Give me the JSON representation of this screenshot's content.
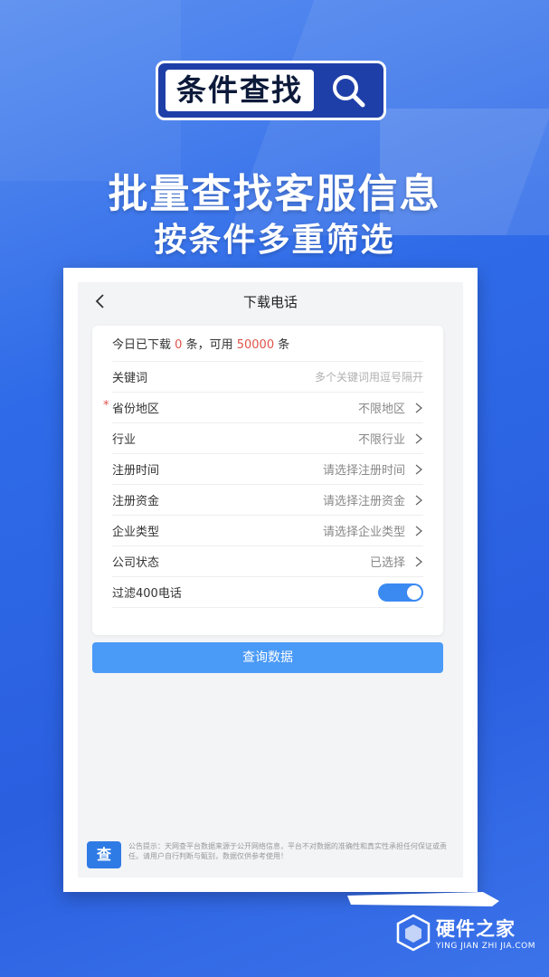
{
  "hero": {
    "badge": "条件查找",
    "title": "批量查找客服信息",
    "subtitle": "按条件多重筛选"
  },
  "nav": {
    "title": "下载电话"
  },
  "quota": {
    "prefix": "今日已下载",
    "downloaded": "0",
    "mid": "条，可用",
    "available": "50000",
    "suffix": "条"
  },
  "fields": [
    {
      "label": "关键词",
      "value": "多个关键词用逗号隔开"
    },
    {
      "label": "省份地区",
      "value": "不限地区",
      "required": "*"
    },
    {
      "label": "行业",
      "value": "不限行业"
    },
    {
      "label": "注册时间",
      "value": "请选择注册时间"
    },
    {
      "label": "注册资金",
      "value": "请选择注册资金"
    },
    {
      "label": "企业类型",
      "value": "请选择企业类型"
    },
    {
      "label": "公司状态",
      "value": "已选择"
    },
    {
      "label": "过滤400电话",
      "toggle_on": true
    }
  ],
  "query_button": "查询数据",
  "notice": {
    "logo": "查",
    "text": "公告提示：天网查平台数据来源于公开网络信息，平台不对数据的准确性和真实性承担任何保证或责任。请用户自行判断与甄别，数据仅供参考使用！"
  },
  "watermark": {
    "cn": "硬件之家",
    "en": "YING JIAN ZHI JIA.COM"
  },
  "colors": {
    "accent": "#4a9af7",
    "highlight": "#e0524a",
    "background": "#2f6be8"
  }
}
